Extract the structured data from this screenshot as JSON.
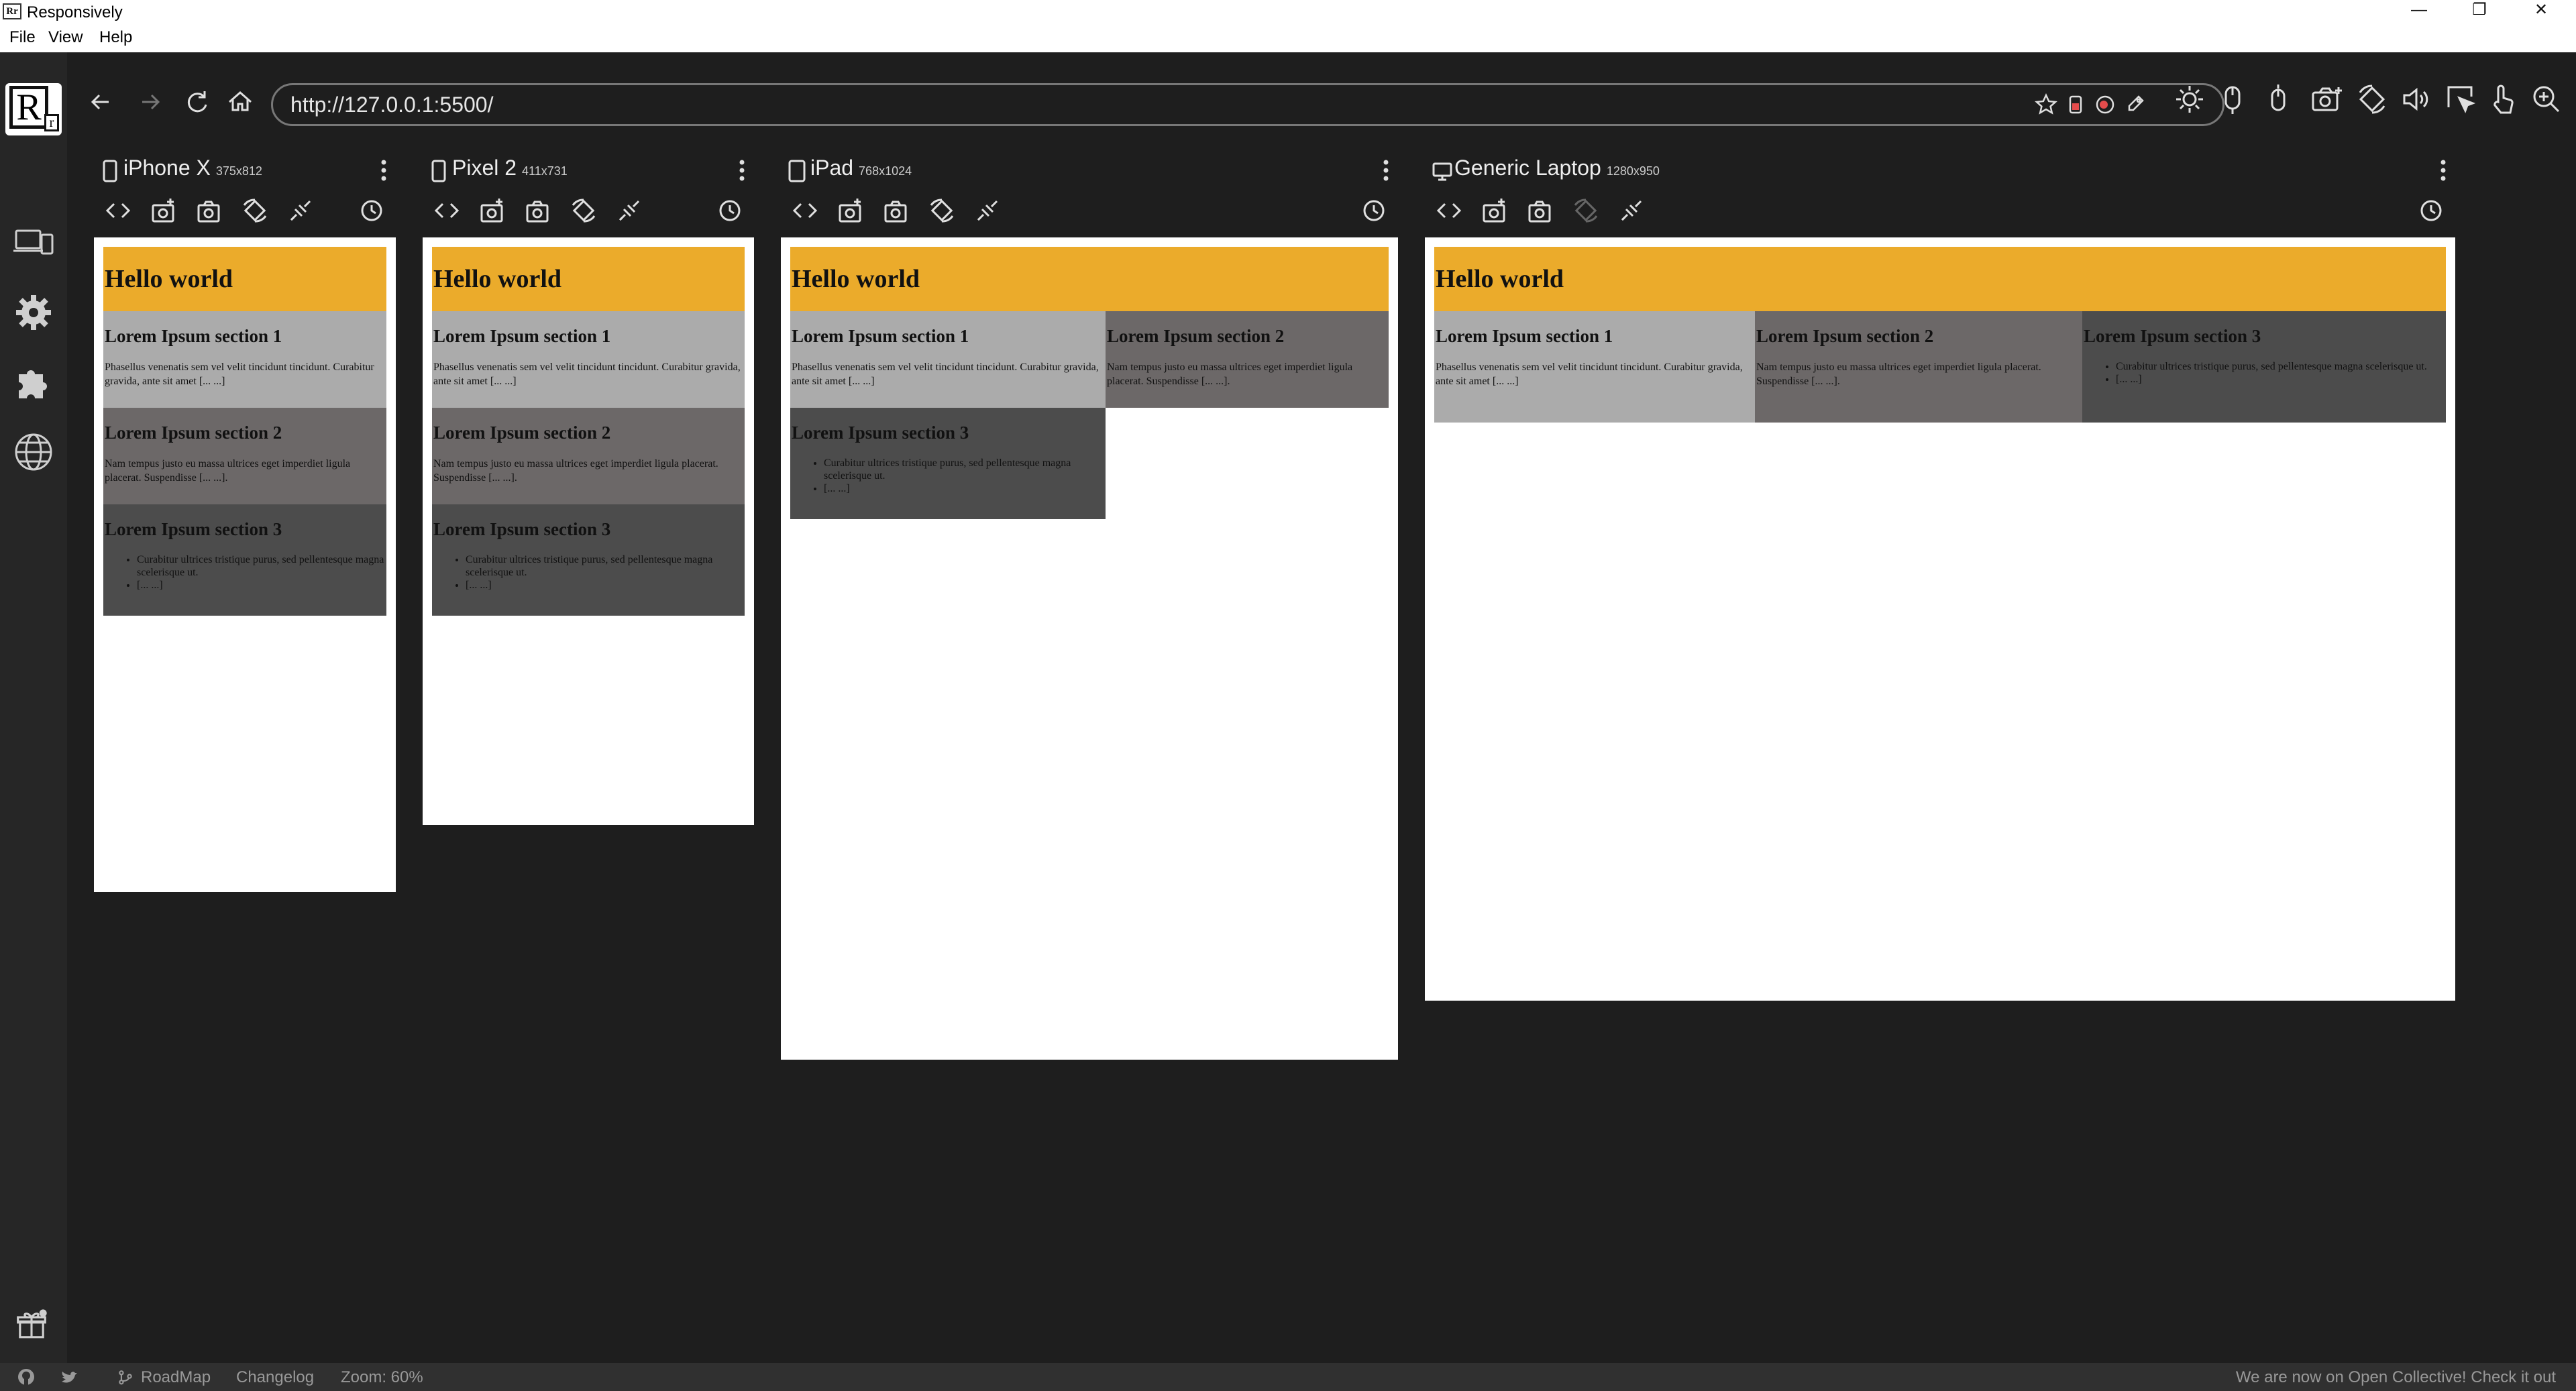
{
  "window": {
    "app_icon_text": "Rr",
    "title": "Responsively",
    "minimize": "—",
    "restore": "❐",
    "close": "✕"
  },
  "menu": [
    "File",
    "View",
    "Help"
  ],
  "logo": {
    "big": "R",
    "small": "r"
  },
  "address_bar": {
    "url": "http://127.0.0.1:5500/"
  },
  "page": {
    "heading": "Hello world",
    "sections": [
      {
        "title": "Lorem Ipsum section 1",
        "text": "Phasellus venenatis sem vel velit tincidunt tincidunt. Curabitur gravida, ante sit amet [... ...]"
      },
      {
        "title": "Lorem Ipsum section 2",
        "text": "Nam tempus justo eu massa ultrices eget imperdiet ligula placerat. Suspendisse [... ...]."
      },
      {
        "title": "Lorem Ipsum section 3",
        "list": [
          "Curabitur ultrices tristique purus, sed pellentesque magna scelerisque ut.",
          "[... ...]"
        ]
      }
    ]
  },
  "devices": [
    {
      "name": "iPhone X",
      "size": "375x812",
      "type": "mobile"
    },
    {
      "name": "Pixel 2",
      "size": "411x731",
      "type": "mobile"
    },
    {
      "name": "iPad",
      "size": "768x1024",
      "type": "tablet"
    },
    {
      "name": "Generic Laptop",
      "size": "1280x950",
      "type": "laptop"
    }
  ],
  "status_bar": {
    "roadmap": "RoadMap",
    "changelog": "Changelog",
    "zoom": "Zoom: 60%",
    "announcement": "We are now on Open Collective! Check it out"
  },
  "colors": {
    "header_bg": "#ebab2b",
    "section1_bg": "#ababab",
    "section2_bg": "#6c6868",
    "section3_bg": "#4c4c4c",
    "app_bg": "#1e1e1e"
  }
}
